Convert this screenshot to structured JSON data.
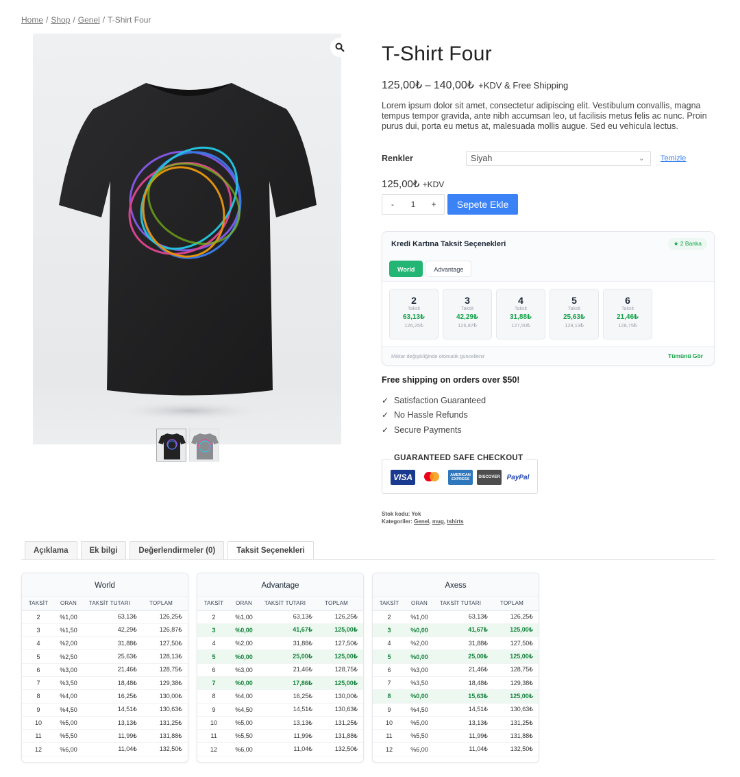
{
  "breadcrumb": {
    "items": [
      "Home",
      "Shop",
      "Genel"
    ],
    "current": "T-Shirt Four"
  },
  "product": {
    "title": "T-Shirt Four",
    "price_min": "125,00₺",
    "price_max": "140,00₺",
    "price_suffix": "+KDV & Free Shipping",
    "description": "Lorem ipsum dolor sit amet, consectetur adipiscing elit. Vestibulum convallis, magna tempus tempor gravida, ante nibh accumsan leo, ut facilisis metus felis ac nunc. Proin purus dui, porta eu metus at, malesuada mollis augue. Sed eu vehicula lectus.",
    "variation_label": "Renkler",
    "variation_value": "Siyah",
    "clear_label": "Temizle",
    "variation_price": "125,00₺",
    "variation_price_suffix": "+KDV",
    "qty_minus": "-",
    "qty_value": "1",
    "qty_plus": "+",
    "add_to_cart": "Sepete Ekle"
  },
  "installment_widget": {
    "title": "Kredi Kartına Taksit Seçenekleri",
    "badge": "★ 2 Banka",
    "tabs": [
      "World",
      "Advantage"
    ],
    "unit_label": "Taksit",
    "cards": [
      {
        "n": "2",
        "monthly": "63,13₺",
        "total": "126,25₺"
      },
      {
        "n": "3",
        "monthly": "42,29₺",
        "total": "126,87₺"
      },
      {
        "n": "4",
        "monthly": "31,88₺",
        "total": "127,50₺"
      },
      {
        "n": "5",
        "monthly": "25,63₺",
        "total": "128,13₺"
      },
      {
        "n": "6",
        "monthly": "21,46₺",
        "total": "128,75₺"
      }
    ],
    "footer_note": "Miktar değişikliğinde otomatik güncellenir",
    "see_all": "Tümünü Gör"
  },
  "shipping_note": "Free shipping on orders over $50!",
  "features": [
    "Satisfaction Guaranteed",
    "No Hassle Refunds",
    "Secure Payments"
  ],
  "safe_checkout": {
    "title": "GUARANTEED SAFE CHECKOUT",
    "cards": [
      "VISA",
      "mastercard",
      "AMERICAN EXPRESS",
      "DISCOVER",
      "PayPal"
    ]
  },
  "meta": {
    "sku_label": "Stok kodu:",
    "sku_value": "Yok",
    "cat_label": "Kategoriler:",
    "categories": [
      "Genel",
      "mug",
      "tshirts"
    ]
  },
  "tabs": [
    "Açıklama",
    "Ek bilgi",
    "Değerlendirmeler (0)",
    "Taksit Seçenekleri"
  ],
  "table_headers": [
    "TAKSİT",
    "ORAN",
    "TAKSİT TUTARI",
    "TOPLAM"
  ],
  "banks": [
    {
      "name": "World",
      "rows": [
        [
          "2",
          "%1,00",
          "63,13₺",
          "126,25₺",
          false
        ],
        [
          "3",
          "%1,50",
          "42,29₺",
          "126,87₺",
          false
        ],
        [
          "4",
          "%2,00",
          "31,88₺",
          "127,50₺",
          false
        ],
        [
          "5",
          "%2,50",
          "25,63₺",
          "128,13₺",
          false
        ],
        [
          "6",
          "%3,00",
          "21,46₺",
          "128,75₺",
          false
        ],
        [
          "7",
          "%3,50",
          "18,48₺",
          "129,38₺",
          false
        ],
        [
          "8",
          "%4,00",
          "16,25₺",
          "130,00₺",
          false
        ],
        [
          "9",
          "%4,50",
          "14,51₺",
          "130,63₺",
          false
        ],
        [
          "10",
          "%5,00",
          "13,13₺",
          "131,25₺",
          false
        ],
        [
          "11",
          "%5,50",
          "11,99₺",
          "131,88₺",
          false
        ],
        [
          "12",
          "%6,00",
          "11,04₺",
          "132,50₺",
          false
        ]
      ]
    },
    {
      "name": "Advantage",
      "rows": [
        [
          "2",
          "%1,00",
          "63,13₺",
          "126,25₺",
          false
        ],
        [
          "3",
          "%0,00",
          "41,67₺",
          "125,00₺",
          true
        ],
        [
          "4",
          "%2,00",
          "31,88₺",
          "127,50₺",
          false
        ],
        [
          "5",
          "%0,00",
          "25,00₺",
          "125,00₺",
          true
        ],
        [
          "6",
          "%3,00",
          "21,46₺",
          "128,75₺",
          false
        ],
        [
          "7",
          "%0,00",
          "17,86₺",
          "125,00₺",
          true
        ],
        [
          "8",
          "%4,00",
          "16,25₺",
          "130,00₺",
          false
        ],
        [
          "9",
          "%4,50",
          "14,51₺",
          "130,63₺",
          false
        ],
        [
          "10",
          "%5,00",
          "13,13₺",
          "131,25₺",
          false
        ],
        [
          "11",
          "%5,50",
          "11,99₺",
          "131,88₺",
          false
        ],
        [
          "12",
          "%6,00",
          "11,04₺",
          "132,50₺",
          false
        ]
      ]
    },
    {
      "name": "Axess",
      "rows": [
        [
          "2",
          "%1,00",
          "63,13₺",
          "126,25₺",
          false
        ],
        [
          "3",
          "%0,00",
          "41,67₺",
          "125,00₺",
          true
        ],
        [
          "4",
          "%2,00",
          "31,88₺",
          "127,50₺",
          false
        ],
        [
          "5",
          "%0,00",
          "25,00₺",
          "125,00₺",
          true
        ],
        [
          "6",
          "%3,00",
          "21,46₺",
          "128,75₺",
          false
        ],
        [
          "7",
          "%3,50",
          "18,48₺",
          "129,38₺",
          false
        ],
        [
          "8",
          "%0,00",
          "15,63₺",
          "125,00₺",
          true
        ],
        [
          "9",
          "%4,50",
          "14,51₺",
          "130,63₺",
          false
        ],
        [
          "10",
          "%5,00",
          "13,13₺",
          "131,25₺",
          false
        ],
        [
          "11",
          "%5,50",
          "11,99₺",
          "131,88₺",
          false
        ],
        [
          "12",
          "%6,00",
          "11,04₺",
          "132,50₺",
          false
        ]
      ]
    }
  ],
  "colors": {
    "primary": "#3b82f6",
    "installment_green": "#22b573",
    "highlight_row": "#edf9f0"
  }
}
